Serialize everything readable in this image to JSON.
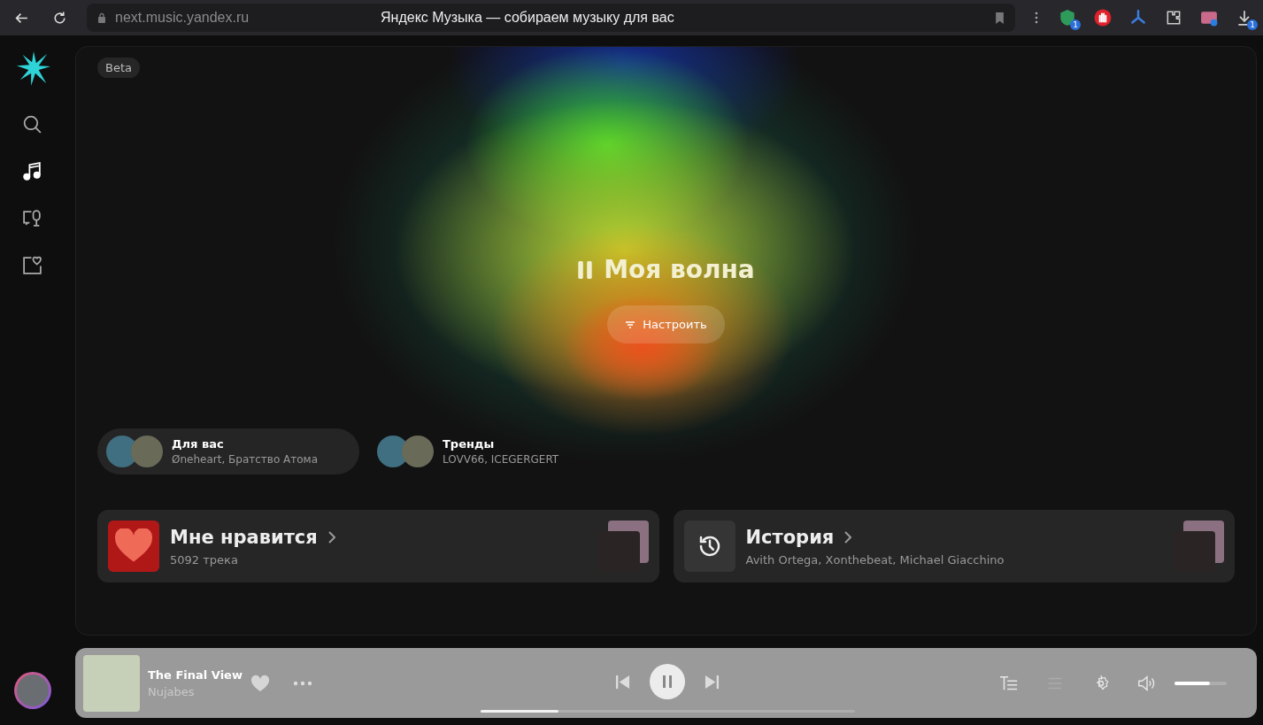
{
  "browser": {
    "url": "next.music.yandex.ru",
    "title": "Яндекс Музыка — собираем музыку для вас",
    "extensions": [
      {
        "kind": "shield",
        "badge": "1"
      },
      {
        "kind": "hand"
      },
      {
        "kind": "star"
      },
      {
        "kind": "puzzle"
      },
      {
        "kind": "picture"
      },
      {
        "kind": "download",
        "badge": "1"
      }
    ]
  },
  "sidebar": {
    "items": [
      {
        "kind": "search",
        "selected": false
      },
      {
        "kind": "music",
        "selected": true
      },
      {
        "kind": "podcasts",
        "selected": false
      },
      {
        "kind": "collection",
        "selected": false
      }
    ]
  },
  "beta_badge": "Beta",
  "wave": {
    "title": "Моя волна",
    "playing": true,
    "tune_button": "Настроить"
  },
  "moods": [
    {
      "title": "Для вас",
      "artists": "Øneheart, Братство Атома",
      "selected": true
    },
    {
      "title": "Тренды",
      "artists": "LOVV66, ICEGERGERT",
      "selected": false
    }
  ],
  "cards": [
    {
      "kind": "likes",
      "title": "Мне нравится",
      "subtitle": "5092 трека"
    },
    {
      "kind": "history",
      "title": "История",
      "subtitle": "Avith Ortega, Xonthebeat, Michael Giacchino"
    }
  ],
  "player": {
    "track": "The Final View",
    "artist": "Nujabes",
    "playing": true,
    "level": 0.21,
    "volume": {
      "level": 0.68
    }
  }
}
